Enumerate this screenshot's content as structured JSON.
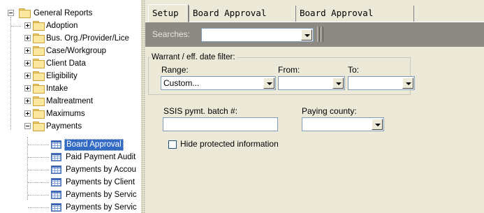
{
  "tree": {
    "root_label": "General Reports",
    "folders": [
      {
        "label": "Adoption"
      },
      {
        "label": "Bus. Org./Provider/Lice"
      },
      {
        "label": "Case/Workgroup"
      },
      {
        "label": "Client Data"
      },
      {
        "label": "Eligibility"
      },
      {
        "label": "Intake"
      },
      {
        "label": "Maltreatment"
      },
      {
        "label": "Maximums"
      },
      {
        "label": "Payments"
      }
    ],
    "reports": [
      {
        "label": "Board Approval",
        "selected": true
      },
      {
        "label": "Paid Payment Audit"
      },
      {
        "label": "Payments by Accou"
      },
      {
        "label": "Payments by Client"
      },
      {
        "label": "Payments by Servic"
      },
      {
        "label": "Payments by Servic"
      }
    ]
  },
  "tabs": [
    {
      "label": "Setup",
      "active": true
    },
    {
      "label": "Board Approval Grid"
    },
    {
      "label": "Board Approval Report"
    }
  ],
  "searchbar": {
    "label": "Searches:",
    "value": ""
  },
  "warrant": {
    "legend": "Warrant / eff. date filter:",
    "range_label": "Range:",
    "range_value": "Custom...",
    "from_label": "From:",
    "from_value": "",
    "to_label": "To:",
    "to_value": ""
  },
  "ssis": {
    "label": "SSIS pymt. batch #:",
    "value": ""
  },
  "paying_county": {
    "label": "Paying county:",
    "value": ""
  },
  "hide_protected": {
    "label": "Hide protected information",
    "checked": false
  },
  "colors": {
    "selection": "#316ac5",
    "search_bar": "#8c8a82",
    "panel_bg": "#ece9d8"
  }
}
